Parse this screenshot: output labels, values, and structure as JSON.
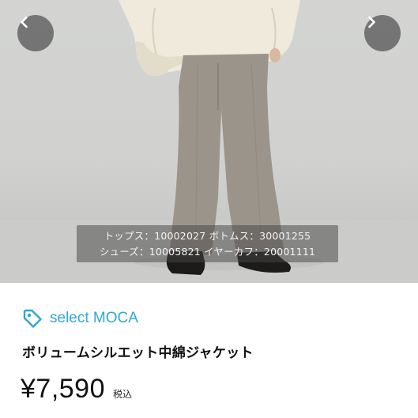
{
  "photo": {
    "caption_line1": "トップス：10002027 ボトムス：30001255",
    "caption_line2": "シューズ：10005821 イヤーカフ：20001111",
    "prev_icon": "chevron-left-icon",
    "next_icon": "chevron-right-icon"
  },
  "shop": {
    "name": "select MOCA",
    "icon": "tag-icon",
    "accent_color": "#2fa7d6"
  },
  "product": {
    "title": "ボリュームシルエット中綿ジャケット",
    "price": "¥7,590",
    "tax_label": "税込"
  }
}
